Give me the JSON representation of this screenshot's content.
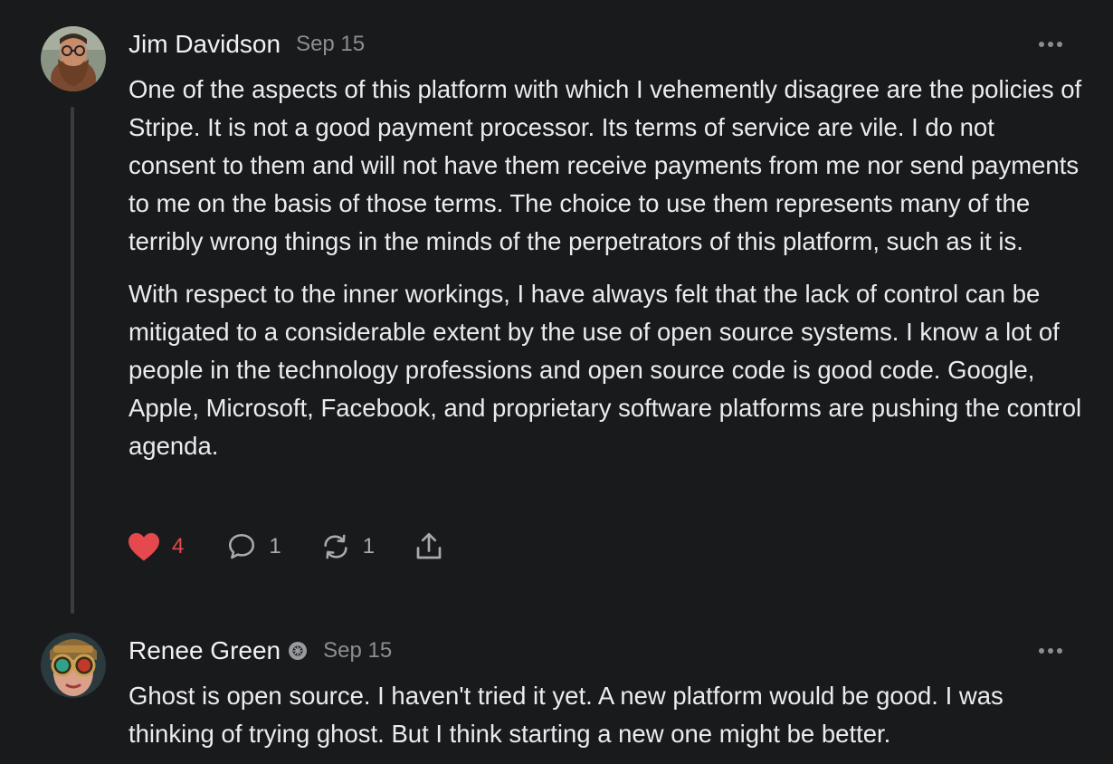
{
  "comments": [
    {
      "author": "Jim Davidson",
      "date": "Sep 15",
      "paragraphs": [
        "One of the aspects of this platform with which I vehemently disagree are the policies of Stripe. It is not a good payment processor. Its terms of service are vile. I do not consent to them and will not have them receive payments from me nor send payments to me on the basis of those terms. The choice to use them represents many of the terribly wrong things in the minds of the perpetrators of this platform, such as it is.",
        "With respect to the inner workings, I have always felt that the lack of control can be mitigated to a considerable extent by the use of open source systems. I know a lot of people in the technology professions and open source code is good code. Google, Apple, Microsoft, Facebook, and proprietary software platforms are pushing the control agenda."
      ],
      "likes": "4",
      "replies": "1",
      "restacks": "1",
      "icons": {
        "avatar": "bearded-man-avatar",
        "like": "heart-icon",
        "reply": "speech-bubble-icon",
        "restack": "repeat-icon",
        "share": "share-icon",
        "more": "ellipsis-icon"
      }
    },
    {
      "author": "Renee Green",
      "date": "Sep 15",
      "paragraphs": [
        "Ghost is open source. I haven't tried it yet. A new platform would be good. I was thinking of trying ghost. But I think starting a new one might be better."
      ],
      "icons": {
        "avatar": "steampunk-goggles-avatar",
        "badge": "badge-icon",
        "more": "ellipsis-icon"
      }
    }
  ],
  "colors": {
    "background": "#191a1c",
    "text": "#ececed",
    "muted": "#8d8e92",
    "like": "#e5484d",
    "thread_line": "#3b3c3f"
  }
}
